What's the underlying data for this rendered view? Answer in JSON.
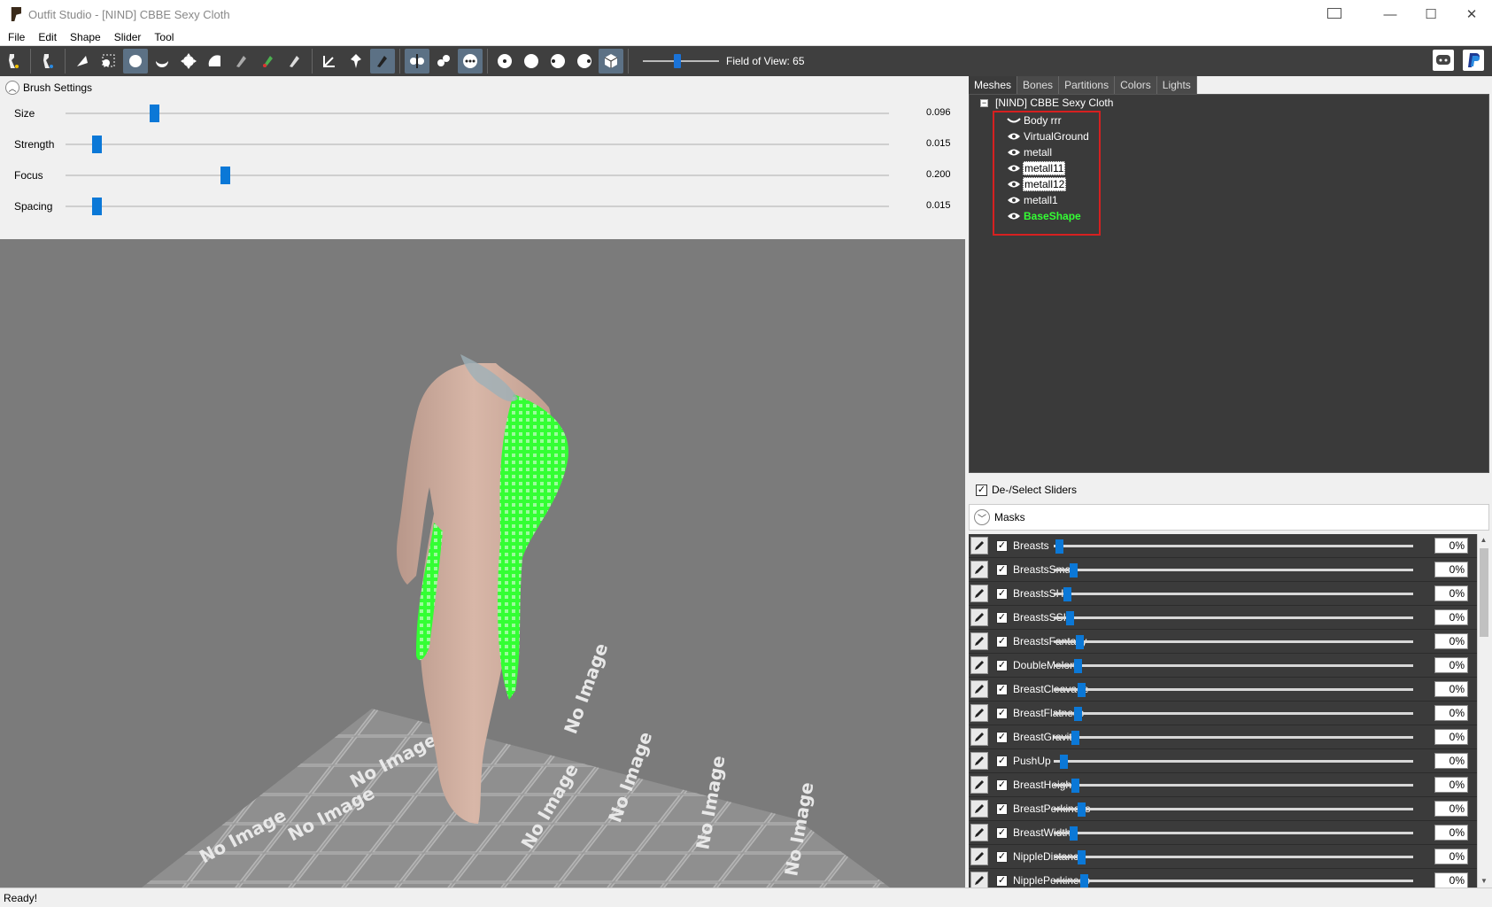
{
  "window": {
    "title": "Outfit Studio - [NIND] CBBE Sexy Cloth",
    "minimize": "—",
    "maximize": "☐",
    "close": "✕"
  },
  "menu": [
    "File",
    "Edit",
    "Shape",
    "Slider",
    "Tool"
  ],
  "toolbar": {
    "fov_label": "Field of View: 65",
    "fov_value_fraction": 0.45
  },
  "brush_settings": {
    "title": "Brush Settings",
    "rows": [
      {
        "label": "Size",
        "value": "0.096",
        "fraction": 0.096
      },
      {
        "label": "Strength",
        "value": "0.015",
        "fraction": 0.015
      },
      {
        "label": "Focus",
        "value": "0.200",
        "fraction": 0.196
      },
      {
        "label": "Spacing",
        "value": "0.015",
        "fraction": 0.015
      }
    ]
  },
  "tabs": [
    "Meshes",
    "Bones",
    "Partitions",
    "Colors",
    "Lights"
  ],
  "mesh_tree": {
    "root": "[NIND] CBBE Sexy Cloth",
    "items": [
      {
        "label": "Body rrr",
        "state": "normal",
        "eye": "hidden"
      },
      {
        "label": "VirtualGround",
        "state": "normal",
        "eye": "visible"
      },
      {
        "label": "metall",
        "state": "normal",
        "eye": "visible"
      },
      {
        "label": "metall11",
        "state": "selected",
        "eye": "visible"
      },
      {
        "label": "metall12",
        "state": "selected",
        "eye": "visible"
      },
      {
        "label": "metall1",
        "state": "normal",
        "eye": "visible"
      },
      {
        "label": "BaseShape",
        "state": "active",
        "eye": "visible"
      }
    ]
  },
  "deselect_label": "De-/Select Sliders",
  "masks_label": "Masks",
  "sliders": [
    {
      "name": "Breasts",
      "value": "0%",
      "fraction": 0.0
    },
    {
      "name": "BreastsSmall",
      "value": "0%",
      "fraction": 0.07
    },
    {
      "name": "BreastsSH",
      "value": "0%",
      "fraction": 0.04
    },
    {
      "name": "BreastsSSH",
      "value": "0%",
      "fraction": 0.05
    },
    {
      "name": "BreastsFantasy",
      "value": "0%",
      "fraction": 0.1
    },
    {
      "name": "DoubleMelon",
      "value": "0%",
      "fraction": 0.09
    },
    {
      "name": "BreastCleavage",
      "value": "0%",
      "fraction": 0.11
    },
    {
      "name": "BreastFlatness",
      "value": "0%",
      "fraction": 0.09
    },
    {
      "name": "BreastGravity",
      "value": "0%",
      "fraction": 0.08
    },
    {
      "name": "PushUp",
      "value": "0%",
      "fraction": 0.02
    },
    {
      "name": "BreastHeight",
      "value": "0%",
      "fraction": 0.08
    },
    {
      "name": "BreastPerkiness",
      "value": "0%",
      "fraction": 0.11
    },
    {
      "name": "BreastWidth",
      "value": "0%",
      "fraction": 0.07
    },
    {
      "name": "NippleDistance",
      "value": "0%",
      "fraction": 0.11
    },
    {
      "name": "NipplePerkiness",
      "value": "0%",
      "fraction": 0.12
    }
  ],
  "floor_tile_text": "No Image",
  "status": "Ready!",
  "colors": {
    "accent": "#0b78d7",
    "highlight_box": "#d62020",
    "active_mesh": "#33ff33",
    "mesh_mask": "#33ff33"
  }
}
